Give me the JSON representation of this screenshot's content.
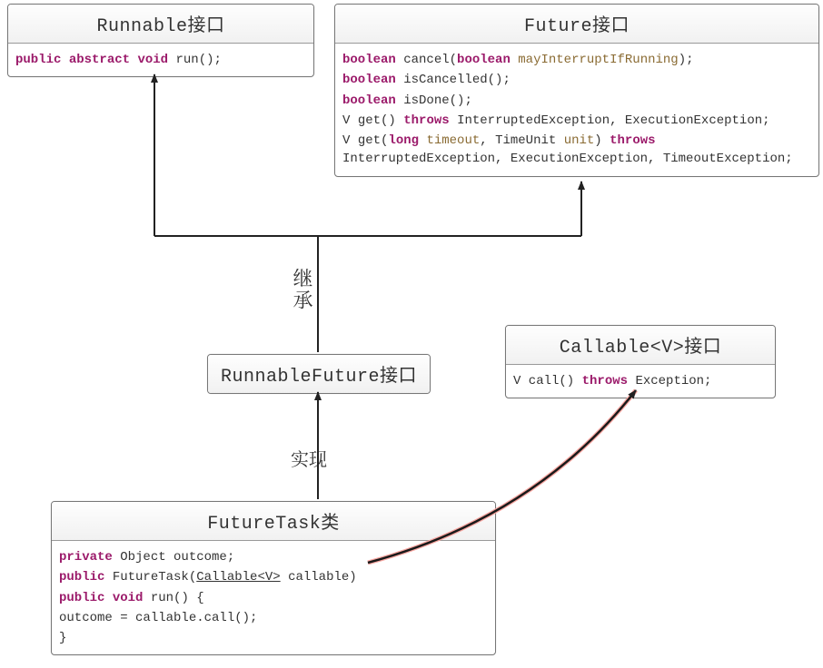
{
  "boxes": {
    "runnable": {
      "title": "Runnable接口",
      "lines": {
        "r1": {
          "kw1": "public",
          "sp1": " ",
          "kw2": "abstract",
          "sp2": " ",
          "kw3": "void",
          "sp3": " ",
          "name": "run",
          "tail": "();"
        }
      }
    },
    "future": {
      "title": "Future接口",
      "lines": {
        "f1": {
          "kw": "boolean",
          "sp": " ",
          "name": "cancel",
          "lp": "(",
          "argkw": "boolean",
          "argsp": " ",
          "argname": "mayInterruptIfRunning",
          "rp": ");"
        },
        "f2": {
          "kw": "boolean",
          "sp": " ",
          "name": "isCancelled",
          "tail": "();"
        },
        "f3": {
          "kw": "boolean",
          "sp": " ",
          "name": "isDone",
          "tail": "();"
        },
        "f4": {
          "ret": "V ",
          "name": "get",
          "mid": "() ",
          "kw": "throws",
          "rest": " InterruptedException, ExecutionException;"
        },
        "f5": {
          "ret": "V ",
          "name": "get",
          "lp": "(",
          "longkw": "long",
          "sp1": " ",
          "timeout": "timeout",
          "comma": ", TimeUnit ",
          "unit": "unit",
          "rp": ") ",
          "kw": "throws",
          "rest": "  InterruptedException, ExecutionException, TimeoutException;"
        }
      }
    },
    "runnablefuture": {
      "title": "RunnableFuture接口"
    },
    "callable": {
      "title": "Callable<V>接口",
      "lines": {
        "c1": {
          "pre": "V call() ",
          "kw": "throws",
          "rest": " Exception;"
        }
      }
    },
    "futuretask": {
      "title": "FutureTask类",
      "lines": {
        "t1": {
          "kw": "private",
          "rest": " Object outcome;"
        },
        "t2": {
          "kw": "public",
          "sp": " FutureTask(",
          "ul": "Callable<V>",
          "rest": " callable)"
        },
        "t3": {
          "kw1": "public",
          "sp1": " ",
          "kw2": "void",
          "rest": " run() {"
        },
        "t4": {
          "indent": "        outcome = callable.call();"
        },
        "t5": {
          "brace": "}"
        }
      }
    }
  },
  "labels": {
    "inherit": "继承",
    "implement": "实现"
  }
}
